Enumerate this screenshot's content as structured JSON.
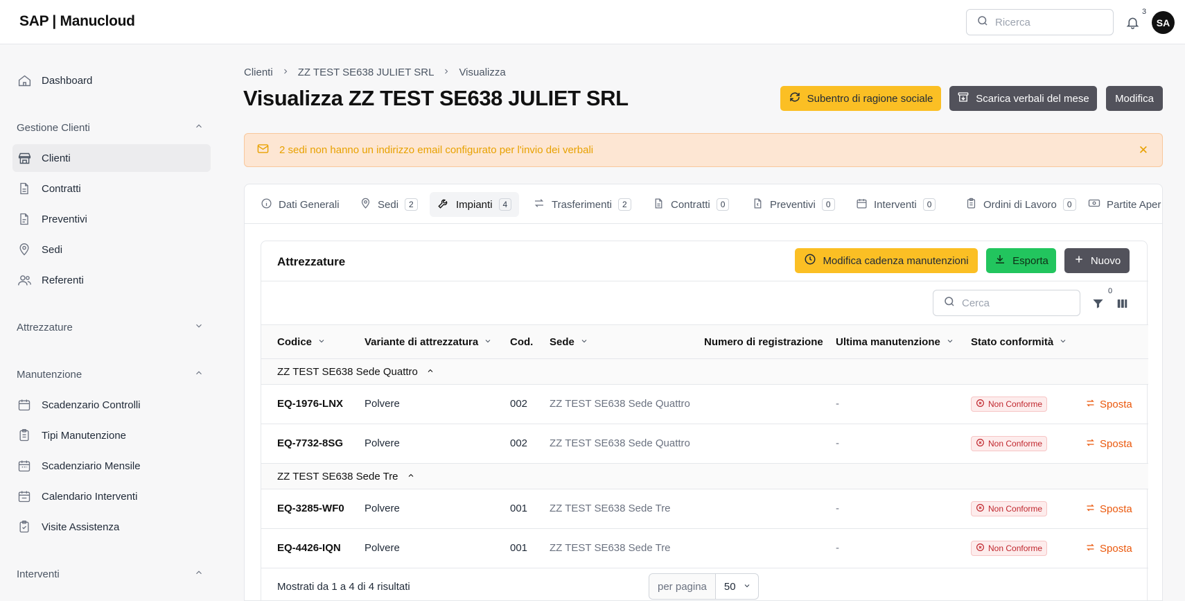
{
  "app": {
    "logo": "SAP | Manucloud"
  },
  "header": {
    "search_placeholder": "Ricerca",
    "notifications_count": "3",
    "avatar_initials": "SA"
  },
  "sidebar": {
    "dashboard": "Dashboard",
    "sections": [
      {
        "label": "Gestione Clienti",
        "items": [
          "Clienti",
          "Contratti",
          "Preventivi",
          "Sedi",
          "Referenti"
        ]
      },
      {
        "label": "Attrezzature",
        "items": []
      },
      {
        "label": "Manutenzione",
        "items": [
          "Scadenzario Controlli",
          "Tipi Manutenzione",
          "Scadenziario Mensile",
          "Calendario Interventi",
          "Visite Assistenza"
        ]
      },
      {
        "label": "Interventi",
        "items": []
      }
    ]
  },
  "breadcrumb": [
    "Clienti",
    "ZZ TEST SE638 JULIET SRL",
    "Visualizza"
  ],
  "page": {
    "title": "Visualizza ZZ TEST SE638 JULIET SRL",
    "actions": {
      "subentro": "Subentro di ragione sociale",
      "scarica": "Scarica verbali del mese",
      "modifica": "Modifica"
    }
  },
  "alert": {
    "text": "2 sedi non hanno un indirizzo email configurato per l'invio dei verbali",
    "close": "✕"
  },
  "tabs": [
    {
      "label": "Dati Generali",
      "count": ""
    },
    {
      "label": "Sedi",
      "count": "2"
    },
    {
      "label": "Impianti",
      "count": "4"
    },
    {
      "label": "Trasferimenti",
      "count": "2"
    },
    {
      "label": "Contratti",
      "count": "0"
    },
    {
      "label": "Preventivi",
      "count": "0"
    },
    {
      "label": "Interventi",
      "count": "0"
    },
    {
      "label": "Ordini di Lavoro",
      "count": "0"
    },
    {
      "label": "Partite Aper",
      "count": ""
    }
  ],
  "panel": {
    "title": "Attrezzature",
    "actions": {
      "cadenza": "Modifica cadenza manutenzioni",
      "esporta": "Esporta",
      "nuovo": "Nuovo"
    },
    "search_placeholder": "Cerca",
    "filter_count": "0"
  },
  "table": {
    "columns": [
      "Codice",
      "Variante di attrezzatura",
      "Cod.",
      "Sede",
      "Numero di registrazione",
      "Ultima manutenzione",
      "Stato conformità"
    ],
    "groups": [
      {
        "name": "ZZ TEST SE638 Sede Quattro",
        "rows": [
          {
            "codice": "EQ-1976-LNX",
            "variante": "Polvere",
            "cod": "002",
            "sede": "ZZ TEST SE638 Sede Quattro",
            "ultima": "-",
            "stato": "Non Conforme",
            "action": "Sposta"
          },
          {
            "codice": "EQ-7732-8SG",
            "variante": "Polvere",
            "cod": "002",
            "sede": "ZZ TEST SE638 Sede Quattro",
            "ultima": "-",
            "stato": "Non Conforme",
            "action": "Sposta"
          }
        ]
      },
      {
        "name": "ZZ TEST SE638 Sede Tre",
        "rows": [
          {
            "codice": "EQ-3285-WF0",
            "variante": "Polvere",
            "cod": "001",
            "sede": "ZZ TEST SE638 Sede Tre",
            "ultima": "-",
            "stato": "Non Conforme",
            "action": "Sposta"
          },
          {
            "codice": "EQ-4426-IQN",
            "variante": "Polvere",
            "cod": "001",
            "sede": "ZZ TEST SE638 Sede Tre",
            "ultima": "-",
            "stato": "Non Conforme",
            "action": "Sposta"
          }
        ]
      }
    ],
    "footer": "Mostrati da 1 a 4 di 4 risultati",
    "per_page_label": "per pagina",
    "per_page_value": "50"
  },
  "colors": {
    "accent_yellow": "#fbbf24",
    "dark_button": "#52525b",
    "green_button": "#22c55e",
    "danger": "#c0262d",
    "action_orange": "#ea580c"
  }
}
